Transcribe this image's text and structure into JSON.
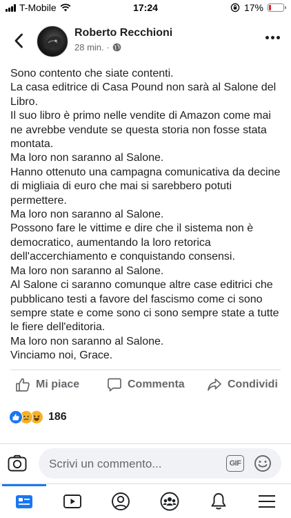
{
  "status_bar": {
    "carrier": "T-Mobile",
    "time": "17:24",
    "battery_percent": "17%",
    "battery_level": 0.17,
    "icons": [
      "signal-icon",
      "wifi-icon",
      "orientation-lock-icon",
      "battery-icon"
    ]
  },
  "post": {
    "author": "Roberto Recchioni",
    "time": "28 min.",
    "separator": "·",
    "privacy_icon": "globe-icon",
    "lines": [
      "Sono contento che siate contenti.",
      "La casa editrice di Casa Pound non sarà al Salone del Libro.",
      "Il suo libro è primo nelle vendite di Amazon come mai ne avrebbe vendute se questa storia non fosse stata montata.",
      "Ma loro non saranno al Salone.",
      "Hanno ottenuto una campagna comunicativa da decine di migliaia di euro che mai si sarebbero potuti permettere.",
      "Ma loro non saranno al Salone.",
      "Possono fare le vittime e dire che il sistema non è democratico, aumentando la loro retorica dell'accerchiamento e conquistando consensi.",
      "Ma loro non saranno al Salone.",
      "Al Salone ci saranno comunque altre case editrici che pubblicano testi a favore del fascismo come ci sono sempre state e come sono ci sono sempre state a tutte le fiere dell'editoria.",
      "Ma loro non saranno al Salone.",
      "Vinciamo noi, Grace."
    ]
  },
  "actions": {
    "like": "Mi piace",
    "comment": "Commenta",
    "share": "Condividi"
  },
  "reactions": {
    "types": [
      "like",
      "sad",
      "haha"
    ],
    "count": "186"
  },
  "comment_bar": {
    "placeholder": "Scrivi un commento...",
    "gif_label": "GIF"
  },
  "bottom_nav": {
    "items": [
      "news-feed-icon",
      "watch-icon",
      "profile-icon",
      "groups-icon",
      "notifications-icon",
      "menu-icon"
    ],
    "active": 0
  },
  "colors": {
    "accent": "#1877f2",
    "text": "#1c1e21",
    "secondary_text": "#65676b",
    "battery_low": "#e0242c"
  }
}
